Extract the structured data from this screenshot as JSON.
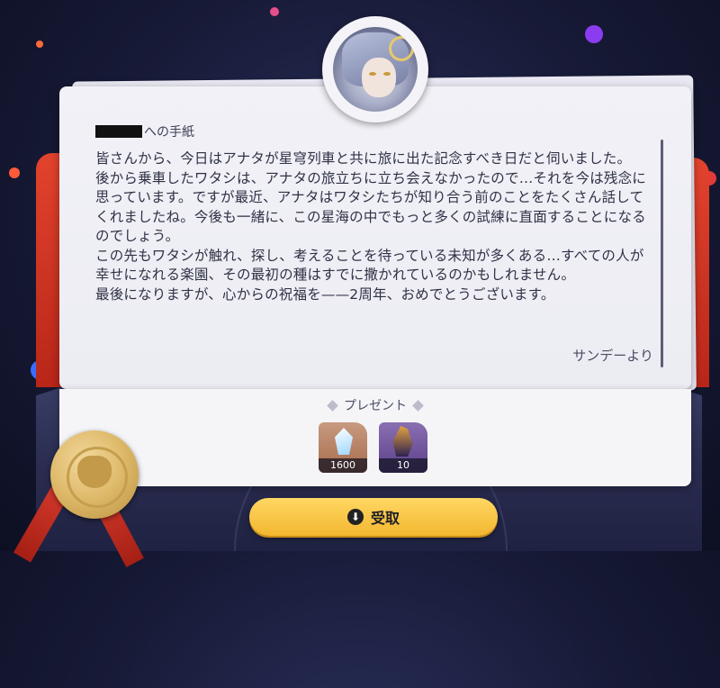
{
  "letter": {
    "greeting_suffix": "への手紙",
    "body": "皆さんから、今日はアナタが星穹列車と共に旅に出た記念すべき日だと伺いました。\n後から乗車したワタシは、アナタの旅立ちに立ち会えなかったので…それを今は残念に思っています。ですが最近、アナタはワタシたちが知り合う前のことをたくさん話してくれましたね。今後も一緒に、この星海の中でもっと多くの試練に直面することになるのでしょう。\nこの先もワタシが触れ、探し、考えることを待っている未知が多くある…すべての人が幸せになれる楽園、その最初の種はすでに撒かれているのかもしれません。\n最後になりますが、心からの祝福を——2周年、おめでとうございます。",
    "signature": "サンデーより"
  },
  "gift": {
    "title": "プレゼント",
    "items": [
      {
        "icon": "stellar-jade-icon",
        "count": "1600"
      },
      {
        "icon": "character-avatar-icon",
        "count": "10"
      }
    ]
  },
  "claim_button": {
    "label": "受取",
    "icon": "download-icon"
  },
  "colors": {
    "accent": "#f3b730",
    "envelope_red": "#d43a2c",
    "card": "#f1f1f7"
  }
}
